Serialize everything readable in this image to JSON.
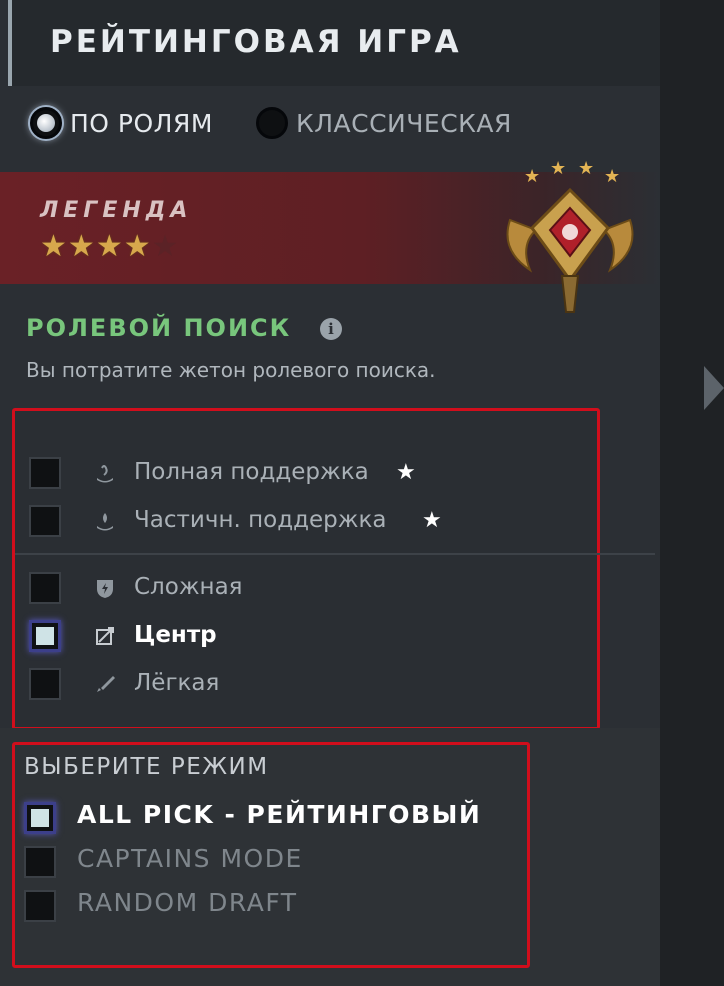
{
  "header": {
    "title": "РЕЙТИНГОВАЯ ИГРА"
  },
  "queue_type": {
    "options": [
      {
        "label": "ПО РОЛЯМ",
        "selected": true
      },
      {
        "label": "КЛАССИЧЕСКАЯ",
        "selected": false
      }
    ]
  },
  "rank": {
    "name": "ЛЕГЕНДА",
    "stars_filled": 4,
    "stars_total": 5,
    "medal_icon": "legend-medal-icon",
    "banner_color": "#6a2126"
  },
  "role_search": {
    "title": "РОЛЕВОЙ ПОИСК",
    "info_icon_glyph": "i",
    "description": "Вы потратите жетон ролевого поиска.",
    "roles": [
      {
        "label": "Полная поддержка",
        "checked": false,
        "icon": "hard-support-icon",
        "star": "★"
      },
      {
        "label": "Частичн. поддержка",
        "checked": false,
        "icon": "soft-support-icon",
        "star": "★"
      },
      {
        "label": "Сложная",
        "checked": false,
        "icon": "offlane-icon"
      },
      {
        "label": "Центр",
        "checked": true,
        "icon": "midlane-icon"
      },
      {
        "label": "Лёгкая",
        "checked": false,
        "icon": "safelane-icon"
      }
    ]
  },
  "game_mode": {
    "title": "ВЫБЕРИТЕ РЕЖИМ",
    "modes": [
      {
        "label": "ALL PICK - РЕЙТИНГОВЫЙ",
        "checked": true
      },
      {
        "label": "CAPTAINS MODE",
        "checked": false
      },
      {
        "label": "RANDOM DRAFT",
        "checked": false
      }
    ]
  },
  "colors": {
    "accent_green": "#78c67c",
    "highlight_red": "#d10e1c",
    "star_gold": "#d7a84c"
  }
}
